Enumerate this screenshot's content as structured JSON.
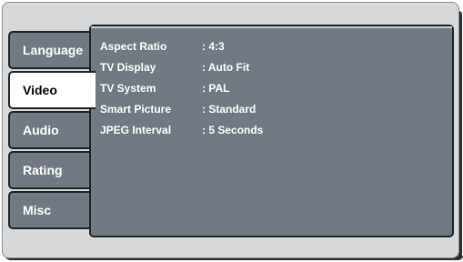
{
  "tabs": [
    {
      "label": "Language",
      "active": false
    },
    {
      "label": "Video",
      "active": true
    },
    {
      "label": "Audio",
      "active": false
    },
    {
      "label": "Rating",
      "active": false
    },
    {
      "label": "Misc",
      "active": false
    }
  ],
  "settings": [
    {
      "label": "Aspect Ratio",
      "value": ": 4:3"
    },
    {
      "label": "TV Display",
      "value": ": Auto Fit"
    },
    {
      "label": "TV System",
      "value": ": PAL"
    },
    {
      "label": "Smart Picture",
      "value": ": Standard"
    },
    {
      "label": "JPEG Interval",
      "value": ": 5 Seconds"
    }
  ],
  "colors": {
    "panel": "#717a82",
    "frame": "#d7d8da",
    "active_tab": "#ffffff",
    "border": "#1f2326"
  }
}
